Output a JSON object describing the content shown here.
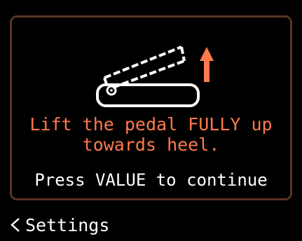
{
  "dialog": {
    "illustration_icon": "pedal-lift-up-icon",
    "arrow_icon": "arrow-up-icon",
    "instruction": "Lift the pedal FULLY up\ntowards heel.",
    "prompt": "Press VALUE to continue"
  },
  "footer": {
    "back_icon": "chevron-left-icon",
    "back_label": "Settings"
  },
  "colors": {
    "background": "#000000",
    "border": "#5a3324",
    "accent": "#ff7a4d",
    "text": "#ffffff"
  }
}
